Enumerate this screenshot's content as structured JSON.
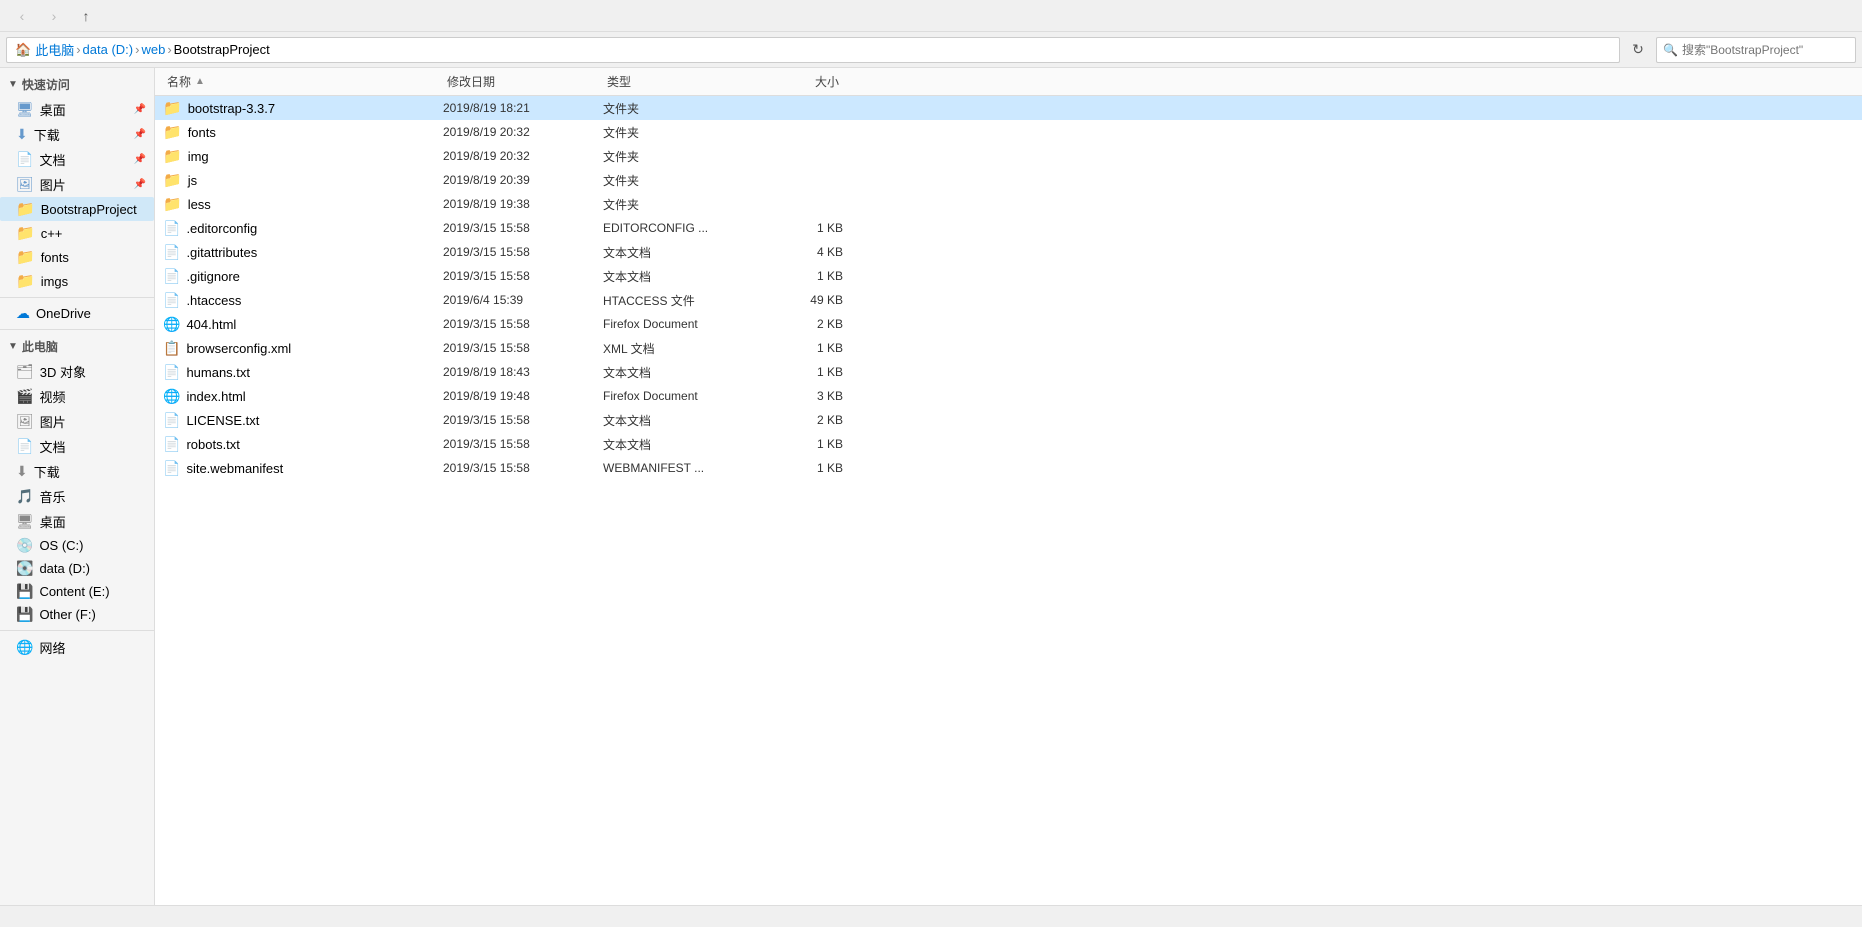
{
  "titlebar": {
    "back_label": "‹",
    "forward_label": "›",
    "up_label": "↑"
  },
  "addressbar": {
    "path": [
      "此电脑",
      "data (D:)",
      "web",
      "BootstrapProject"
    ],
    "search_placeholder": "搜索\"BootstrapProject\""
  },
  "sidebar": {
    "quick_access_label": "快速访问",
    "items_quick": [
      {
        "label": "桌面",
        "icon": "desktop",
        "pinned": true
      },
      {
        "label": "下载",
        "icon": "download",
        "pinned": true
      },
      {
        "label": "文档",
        "icon": "document",
        "pinned": true
      },
      {
        "label": "图片",
        "icon": "picture",
        "pinned": true
      },
      {
        "label": "BootstrapProject",
        "icon": "folder-blue",
        "active": true
      },
      {
        "label": "c++",
        "icon": "folder-yellow"
      },
      {
        "label": "fonts",
        "icon": "folder-yellow"
      },
      {
        "label": "imgs",
        "icon": "folder-yellow"
      }
    ],
    "onedrive_label": "OneDrive",
    "this_pc_label": "此电脑",
    "items_pc": [
      {
        "label": "3D 对象",
        "icon": "folder-special"
      },
      {
        "label": "视频",
        "icon": "folder-special"
      },
      {
        "label": "图片",
        "icon": "folder-special"
      },
      {
        "label": "文档",
        "icon": "folder-special"
      },
      {
        "label": "下载",
        "icon": "folder-special"
      },
      {
        "label": "音乐",
        "icon": "folder-special"
      },
      {
        "label": "桌面",
        "icon": "folder-special"
      },
      {
        "label": "OS (C:)",
        "icon": "drive-c"
      },
      {
        "label": "data (D:)",
        "icon": "drive-d"
      },
      {
        "label": "Content (E:)",
        "icon": "drive-e"
      }
    ],
    "other_label": "Other (F:)",
    "network_label": "网络"
  },
  "columns": {
    "name": "名称",
    "date": "修改日期",
    "type": "类型",
    "size": "大小"
  },
  "files": [
    {
      "name": "bootstrap-3.3.7",
      "date": "2019/8/19 18:21",
      "type": "文件夹",
      "size": "",
      "icon": "folder-blue",
      "selected": true
    },
    {
      "name": "fonts",
      "date": "2019/8/19 20:32",
      "type": "文件夹",
      "size": "",
      "icon": "folder-blue"
    },
    {
      "name": "img",
      "date": "2019/8/19 20:32",
      "type": "文件夹",
      "size": "",
      "icon": "folder-blue"
    },
    {
      "name": "js",
      "date": "2019/8/19 20:39",
      "type": "文件夹",
      "size": "",
      "icon": "folder-blue"
    },
    {
      "name": "less",
      "date": "2019/8/19 19:38",
      "type": "文件夹",
      "size": "",
      "icon": "folder-blue"
    },
    {
      "name": ".editorconfig",
      "date": "2019/3/15 15:58",
      "type": "EDITORCONFIG ...",
      "size": "1 KB",
      "icon": "file"
    },
    {
      "name": ".gitattributes",
      "date": "2019/3/15 15:58",
      "type": "文本文档",
      "size": "4 KB",
      "icon": "file"
    },
    {
      "name": ".gitignore",
      "date": "2019/3/15 15:58",
      "type": "文本文档",
      "size": "1 KB",
      "icon": "file"
    },
    {
      "name": ".htaccess",
      "date": "2019/6/4 15:39",
      "type": "HTACCESS 文件",
      "size": "49 KB",
      "icon": "file"
    },
    {
      "name": "404.html",
      "date": "2019/3/15 15:58",
      "type": "Firefox Document",
      "size": "2 KB",
      "icon": "html"
    },
    {
      "name": "browserconfig.xml",
      "date": "2019/3/15 15:58",
      "type": "XML 文档",
      "size": "1 KB",
      "icon": "xml"
    },
    {
      "name": "humans.txt",
      "date": "2019/8/19 18:43",
      "type": "文本文档",
      "size": "1 KB",
      "icon": "file"
    },
    {
      "name": "index.html",
      "date": "2019/8/19 19:48",
      "type": "Firefox Document",
      "size": "3 KB",
      "icon": "html"
    },
    {
      "name": "LICENSE.txt",
      "date": "2019/3/15 15:58",
      "type": "文本文档",
      "size": "2 KB",
      "icon": "file"
    },
    {
      "name": "robots.txt",
      "date": "2019/3/15 15:58",
      "type": "文本文档",
      "size": "1 KB",
      "icon": "file"
    },
    {
      "name": "site.webmanifest",
      "date": "2019/3/15 15:58",
      "type": "WEBMANIFEST ...",
      "size": "1 KB",
      "icon": "file"
    }
  ],
  "status": {
    "text": ""
  },
  "colors": {
    "selected_bg": "#cce8ff",
    "hover_bg": "#e8f4fc",
    "accent": "#0078d7"
  }
}
